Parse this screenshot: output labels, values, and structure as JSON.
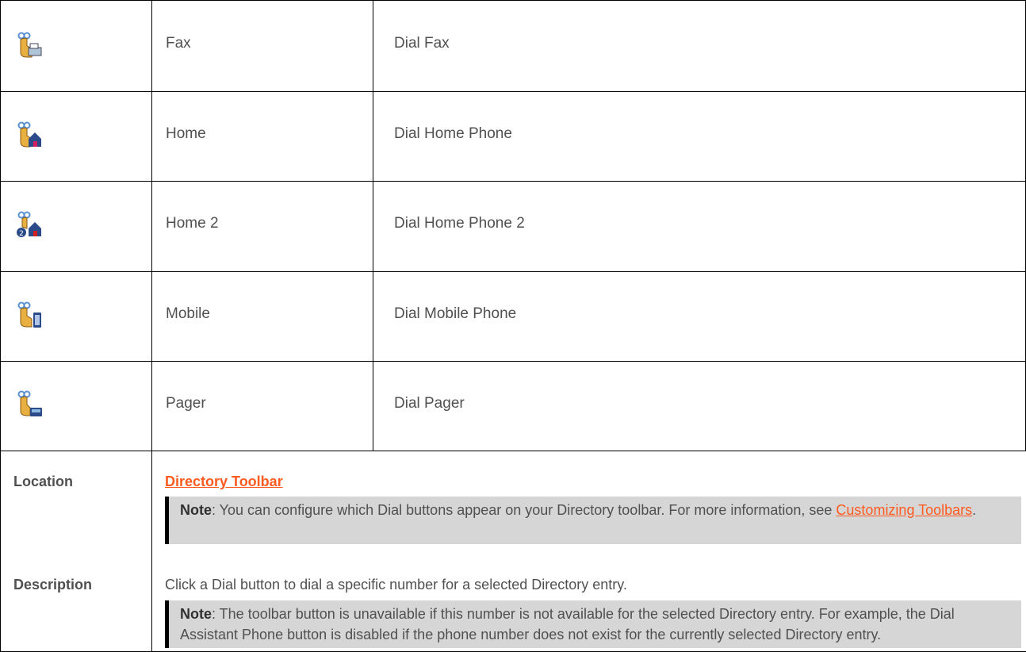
{
  "rows": [
    {
      "icon": "fax-dial-icon",
      "name": "Fax",
      "action": "Dial Fax"
    },
    {
      "icon": "home-dial-icon",
      "name": "Home",
      "action": "Dial Home Phone"
    },
    {
      "icon": "home2-dial-icon",
      "name": "Home 2",
      "action": "Dial Home Phone 2"
    },
    {
      "icon": "mobile-dial-icon",
      "name": "Mobile",
      "action": "Dial Mobile Phone"
    },
    {
      "icon": "pager-dial-icon",
      "name": "Pager",
      "action": "Dial Pager"
    }
  ],
  "location": {
    "label": "Location",
    "link": "Directory Toolbar",
    "note_bold": "Note",
    "note_text": ": You can configure which Dial buttons appear on your Directory toolbar. For more information, see ",
    "note_link": "Customizing Toolbars",
    "note_end": "."
  },
  "description": {
    "label": "Description",
    "text": "Click a Dial button to dial a specific number for a selected Directory entry.",
    "note_bold": "Note",
    "note_text": ": The toolbar button is unavailable if this number is not available for the selected Directory entry. For example, the Dial Assistant Phone button is disabled if the phone number does not exist for the currently selected Directory entry."
  },
  "colors": {
    "link": "#ff5a1f",
    "note_bg": "#d6d6d6",
    "text": "#505050"
  }
}
